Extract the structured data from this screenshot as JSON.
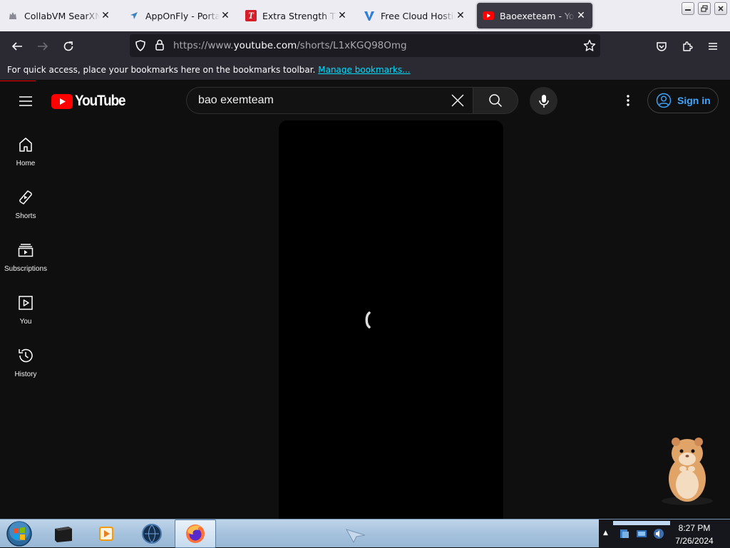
{
  "browser": {
    "tabs": [
      {
        "title": "CollabVM SearXNG",
        "icon": "wolf-icon",
        "active": false
      },
      {
        "title": "AppOnFly - Portal",
        "icon": "paper-plane-icon",
        "active": false
      },
      {
        "title": "Extra Strength TYLENOL",
        "icon": "tylenol-icon",
        "active": false
      },
      {
        "title": "Free Cloud Hosting to",
        "icon": "v-logo-icon",
        "active": false
      },
      {
        "title": "Baoexeteam - YouTube",
        "icon": "youtube-icon",
        "active": true
      }
    ],
    "url_prefix": "https://www.",
    "url_host": "youtube.com",
    "url_path": "/shorts/L1xKGQ98Omg",
    "bookmarks_message": "For quick access, place your bookmarks here on the bookmarks toolbar.",
    "bookmarks_link": "Manage bookmarks..."
  },
  "youtube": {
    "logo_text": "YouTube",
    "search_value": "bao exemteam",
    "signin_label": "Sign in",
    "guide": [
      {
        "label": "Home",
        "icon": "home-icon"
      },
      {
        "label": "Shorts",
        "icon": "shorts-icon"
      },
      {
        "label": "Subscriptions",
        "icon": "subscriptions-icon"
      },
      {
        "label": "You",
        "icon": "you-icon"
      },
      {
        "label": "History",
        "icon": "history-icon"
      }
    ],
    "player_state": "loading"
  },
  "taskbar": {
    "items": [
      "terminal-icon",
      "media-player-icon",
      "globe-app-icon",
      "firefox-icon"
    ],
    "active_item": "firefox-icon",
    "time": "8:27 PM",
    "date": "7/26/2024"
  },
  "colors": {
    "youtube_red": "#ff0000",
    "link_blue": "#3ea6ff",
    "page_bg": "#0f0f0f",
    "toolbar_bg": "#2b2a33"
  }
}
